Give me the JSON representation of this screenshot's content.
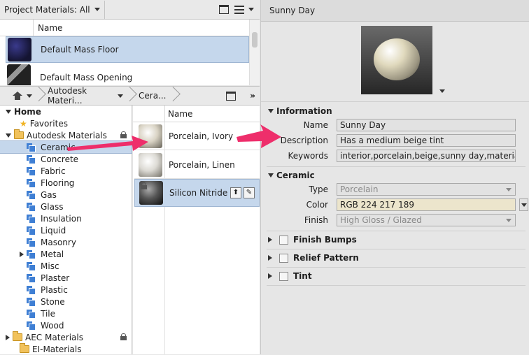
{
  "project_panel": {
    "title": "Project Materials: All",
    "column_name": "Name",
    "rows": [
      {
        "name": "Default Mass Floor"
      },
      {
        "name": "Default Mass Opening"
      }
    ]
  },
  "library_nav": {
    "crumbs": [
      "Autodesk Materi...",
      "Cera..."
    ]
  },
  "tree": {
    "items": [
      {
        "label": "Home"
      },
      {
        "label": "Favorites"
      },
      {
        "label": "Autodesk Materials"
      },
      {
        "label": "Ceramic"
      },
      {
        "label": "Concrete"
      },
      {
        "label": "Fabric"
      },
      {
        "label": "Flooring"
      },
      {
        "label": "Gas"
      },
      {
        "label": "Glass"
      },
      {
        "label": "Insulation"
      },
      {
        "label": "Liquid"
      },
      {
        "label": "Masonry"
      },
      {
        "label": "Metal"
      },
      {
        "label": "Misc"
      },
      {
        "label": "Plaster"
      },
      {
        "label": "Plastic"
      },
      {
        "label": "Stone"
      },
      {
        "label": "Tile"
      },
      {
        "label": "Wood"
      },
      {
        "label": "AEC Materials"
      },
      {
        "label": "EI-Materials"
      }
    ]
  },
  "materials_list": {
    "column_name": "Name",
    "items": [
      {
        "name": "Porcelain, Ivory"
      },
      {
        "name": "Porcelain, Linen"
      },
      {
        "name": "Silicon Nitride"
      }
    ]
  },
  "editor": {
    "title": "Sunny Day",
    "information": {
      "heading": "Information",
      "name_label": "Name",
      "name_value": "Sunny Day",
      "description_label": "Description",
      "description_value": "Has a medium beige tint",
      "keywords_label": "Keywords",
      "keywords_value": "interior,porcelain,beige,sunny day,materials"
    },
    "ceramic": {
      "heading": "Ceramic",
      "type_label": "Type",
      "type_value": "Porcelain",
      "color_label": "Color",
      "color_value": "RGB 224 217 189",
      "finish_label": "Finish",
      "finish_value": "High Gloss / Glazed"
    },
    "finish_bumps": "Finish Bumps",
    "relief_pattern": "Relief Pattern",
    "tint": "Tint"
  },
  "colors": {
    "selection": "#c5d7ec",
    "color_swatch": "#e0d9bd",
    "arrow": "#ee2e6b"
  }
}
